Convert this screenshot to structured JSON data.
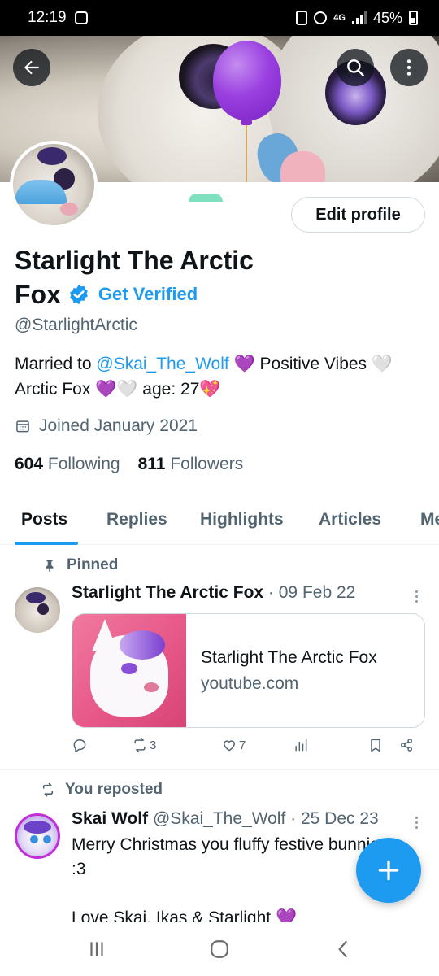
{
  "status_bar": {
    "time": "12:19",
    "network": "4G",
    "battery": "45%"
  },
  "profile": {
    "name_line1": "Starlight The Arctic",
    "name_line2": "Fox",
    "get_verified": "Get Verified",
    "handle": "@StarlightArctic",
    "bio_prefix": "Married to ",
    "bio_mention": "@Skai_The_Wolf",
    "bio_line1_rest": " 💜 Positive Vibes 🤍",
    "bio_line2": "Arctic Fox 💜🤍 age: 27💖",
    "joined": "Joined January 2021",
    "following_count": "604",
    "following_label": "Following",
    "followers_count": "811",
    "followers_label": "Followers",
    "edit_button": "Edit profile"
  },
  "tabs": [
    "Posts",
    "Replies",
    "Highlights",
    "Articles",
    "Media"
  ],
  "pinned_post": {
    "context": "Pinned",
    "author": "Starlight The Arctic Fox",
    "meta": " · 09 Feb 22",
    "card_title": "Starlight The Arctic Fox",
    "card_domain": "youtube.com",
    "retweets": "3",
    "likes": "7"
  },
  "repost": {
    "context": "You reposted",
    "author": "Skai Wolf",
    "meta": " @Skai_The_Wolf · 25 Dec 23",
    "text_line1": "Merry Christmas you fluffy festive bunnies!",
    "text_line2": ":3",
    "text_line3": "Love Skai, Ikas & Starlight 💜"
  },
  "colors": {
    "accent": "#1d9bf0",
    "text": "#0f1419",
    "muted": "#536471"
  },
  "icons": [
    "back-arrow-icon",
    "search-icon",
    "more-vertical-icon",
    "verified-badge-icon",
    "calendar-icon",
    "pin-icon",
    "repost-icon",
    "reply-icon",
    "like-icon",
    "views-icon",
    "bookmark-icon",
    "share-icon",
    "compose-plus-icon",
    "recents-icon",
    "home-icon",
    "back-nav-icon"
  ]
}
